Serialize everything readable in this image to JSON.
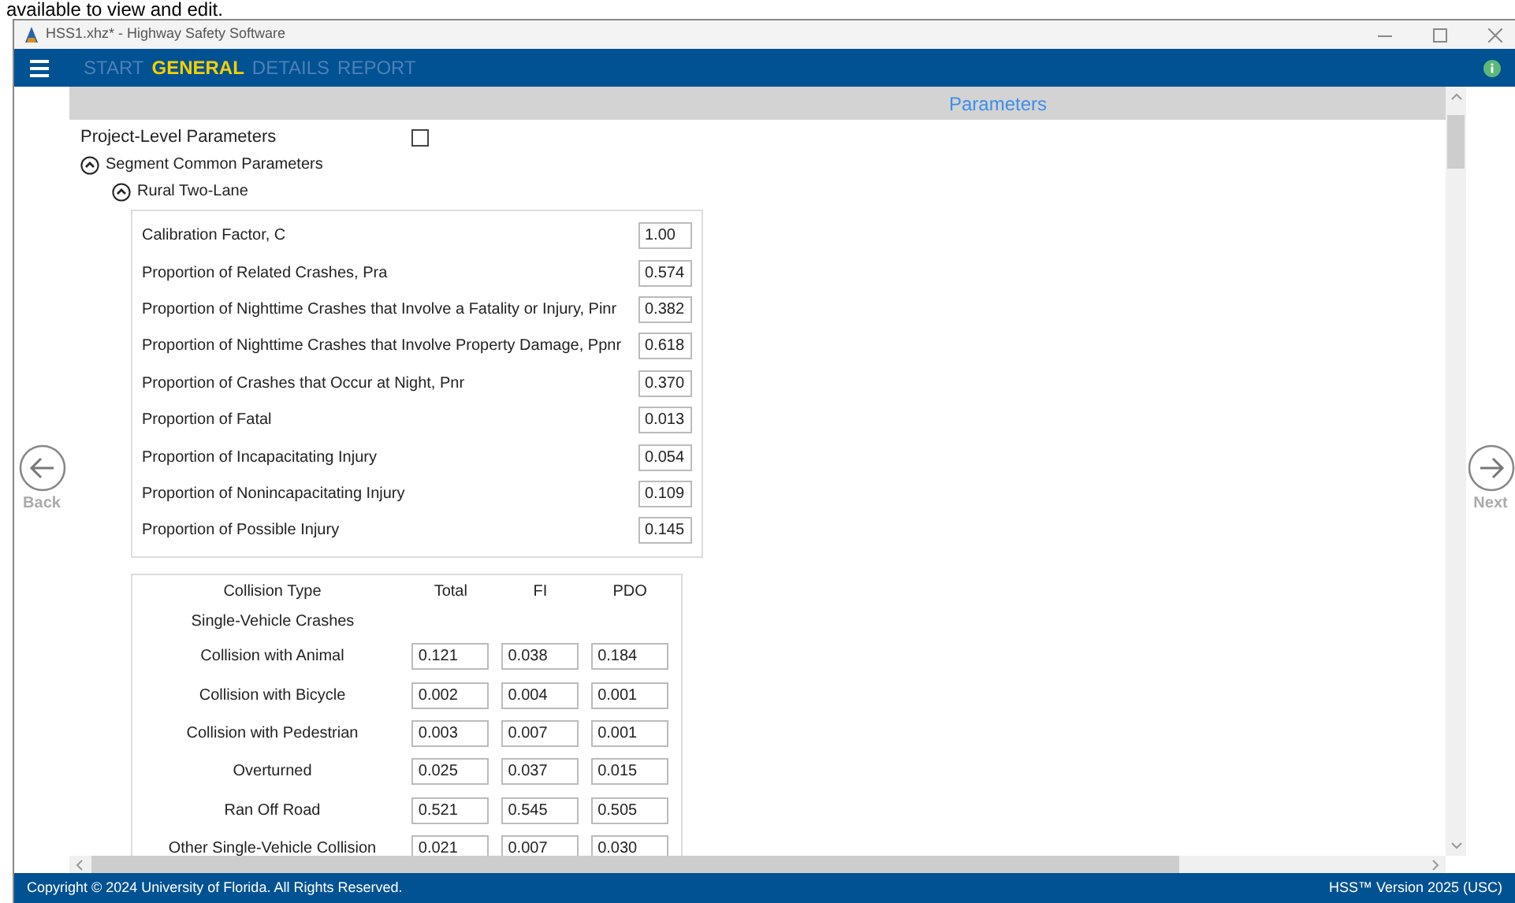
{
  "caption": "available to view and edit.",
  "window": {
    "title": "HSS1.xhz* - Highway Safety Software"
  },
  "tabs": [
    {
      "label": "START",
      "selected": false
    },
    {
      "label": "GENERAL",
      "selected": true
    },
    {
      "label": "DETAILS",
      "selected": false
    },
    {
      "label": "REPORT",
      "selected": false
    }
  ],
  "section_header": "Parameters",
  "project_level": {
    "label": "Project-Level Parameters",
    "checked": false
  },
  "groups": [
    {
      "label": "Segment Common Parameters",
      "expanded": true,
      "children": [
        {
          "label": "Rural Two-Lane",
          "expanded": true
        }
      ]
    }
  ],
  "parameters": [
    {
      "label": "Calibration Factor, C",
      "value": "1.00"
    },
    {
      "label": "Proportion of Related Crashes, Pra",
      "value": "0.574"
    },
    {
      "label": "Proportion of Nighttime Crashes that Involve a Fatality or Injury, Pinr",
      "value": "0.382"
    },
    {
      "label": "Proportion of Nighttime Crashes that Involve Property Damage, Ppnr",
      "value": "0.618"
    },
    {
      "label": "Proportion of Crashes that Occur at Night, Pnr",
      "value": "0.370"
    },
    {
      "label": "Proportion of Fatal",
      "value": "0.013"
    },
    {
      "label": "Proportion of Incapacitating Injury",
      "value": "0.054"
    },
    {
      "label": "Proportion of Nonincapacitating Injury",
      "value": "0.109"
    },
    {
      "label": "Proportion of Possible Injury",
      "value": "0.145"
    }
  ],
  "collision_table": {
    "columns": [
      "Collision Type",
      "Total",
      "FI",
      "PDO"
    ],
    "rows": [
      {
        "kind": "heading",
        "label": "Single-Vehicle Crashes"
      },
      {
        "kind": "values",
        "label": "Collision with Animal",
        "values": [
          "0.121",
          "0.038",
          "0.184"
        ]
      },
      {
        "kind": "values",
        "label": "Collision with Bicycle",
        "values": [
          "0.002",
          "0.004",
          "0.001"
        ]
      },
      {
        "kind": "values",
        "label": "Collision with Pedestrian",
        "values": [
          "0.003",
          "0.007",
          "0.001"
        ]
      },
      {
        "kind": "values",
        "label": "Overturned",
        "values": [
          "0.025",
          "0.037",
          "0.015"
        ]
      },
      {
        "kind": "values",
        "label": "Ran Off Road",
        "values": [
          "0.521",
          "0.545",
          "0.505"
        ]
      },
      {
        "kind": "values",
        "label": "Other Single-Vehicle Collision",
        "values": [
          "0.021",
          "0.007",
          "0.030"
        ]
      }
    ]
  },
  "back": {
    "label": "Back",
    "disabled": true
  },
  "next": {
    "label": "Next",
    "disabled": true
  },
  "footer": {
    "copyright": "Copyright © 2024 University of Florida. All Rights Reserved.",
    "version": "HSS™ Version 2025 (USC)"
  }
}
